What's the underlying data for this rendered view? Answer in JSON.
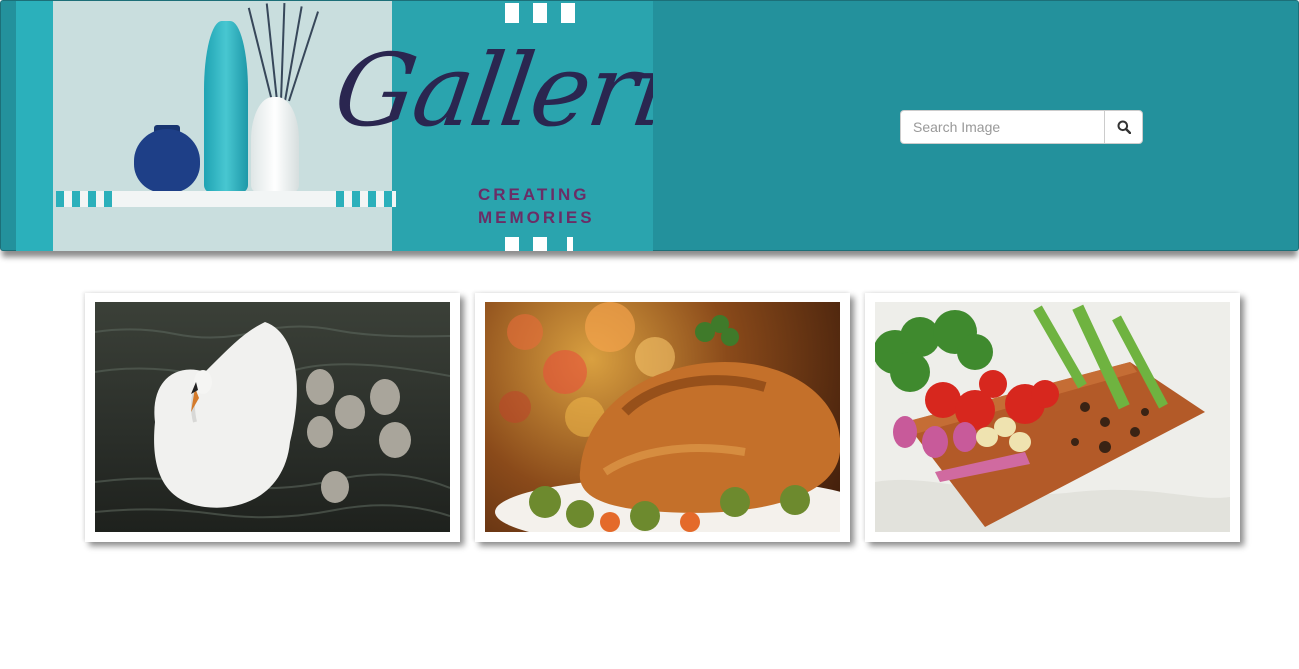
{
  "banner": {
    "title": "Galleria",
    "subtitle_line1": "CREATING",
    "subtitle_line2": "MEMORIES"
  },
  "search": {
    "placeholder": "Search Image",
    "icon": "search-icon"
  },
  "gallery": {
    "items": [
      {
        "subject": "swan-with-cygnets"
      },
      {
        "subject": "roast-chicken"
      },
      {
        "subject": "vegetables-on-board"
      }
    ]
  },
  "colors": {
    "header_bg": "#23919c",
    "logo_text": "#2a2650",
    "logo_subtext": "#6b2d66"
  }
}
